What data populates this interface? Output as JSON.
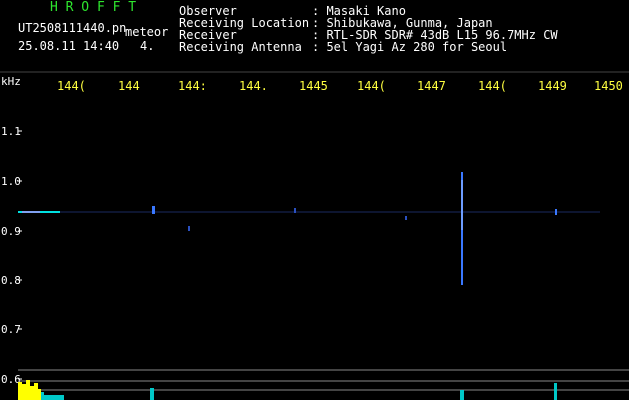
{
  "header": {
    "brand": "H R O F F T",
    "filename": "UT2508111440.pn",
    "mode": "meteor",
    "datetime": "25.08.11 14:40",
    "count": "4.",
    "fields": [
      {
        "label": "Observer",
        "value": ": Masaki Kano"
      },
      {
        "label": "Receiving Location",
        "value": ": Shibukawa, Gunma, Japan"
      },
      {
        "label": "Receiver",
        "value": ": RTL-SDR SDR# 43dB L15 96.7MHz CW"
      },
      {
        "label": "Receiving Antenna",
        "value": ": 5el Yagi Az 280 for Seoul"
      }
    ]
  },
  "axes": {
    "y_unit": "kHz",
    "y_ticks": [
      "1.1",
      "1.0",
      "0.9",
      "0.8",
      "0.7",
      "0.6"
    ],
    "x_ticks": [
      "144(",
      "144",
      "144:",
      "144.",
      "1445",
      "144(",
      "1447",
      "144(",
      "1449",
      "1450"
    ]
  },
  "colors": {
    "background": "#000000",
    "header_text": "#ffffff",
    "brand": "#2ee62e",
    "x_ticks": "#ffff40",
    "signal": "#3a78ff",
    "trace": "#00e0e0",
    "meter": "#ffff00"
  }
}
